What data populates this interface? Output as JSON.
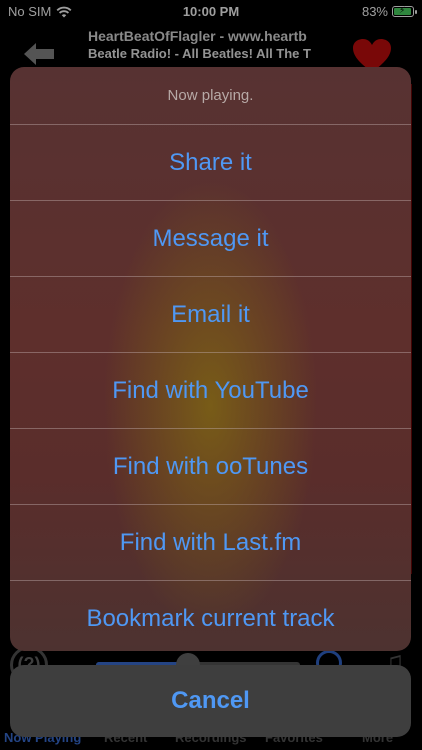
{
  "status_bar": {
    "carrier": "No SIM",
    "time": "10:00 PM",
    "battery": "83%",
    "battery_level": 0.83
  },
  "header": {
    "station": "HeartBeatOfFlagler - www.heartb",
    "track": "Beatle Radio! - All Beatles! All The T"
  },
  "background_controls": {
    "help_label": "(?)",
    "volume_level": 0.45
  },
  "tab_bar": {
    "tabs": [
      "Now Playing",
      "Recent",
      "Recordings",
      "Favorites",
      "More"
    ]
  },
  "action_sheet": {
    "title": "Now playing.",
    "options": [
      "Share it",
      "Message it",
      "Email it",
      "Find with YouTube",
      "Find with ooTunes",
      "Find with Last.fm",
      "Bookmark current track"
    ],
    "cancel_label": "Cancel"
  },
  "colors": {
    "accent": "#4f98f4",
    "panel_red": "#a80d0d",
    "heart": "#c40d0d"
  }
}
